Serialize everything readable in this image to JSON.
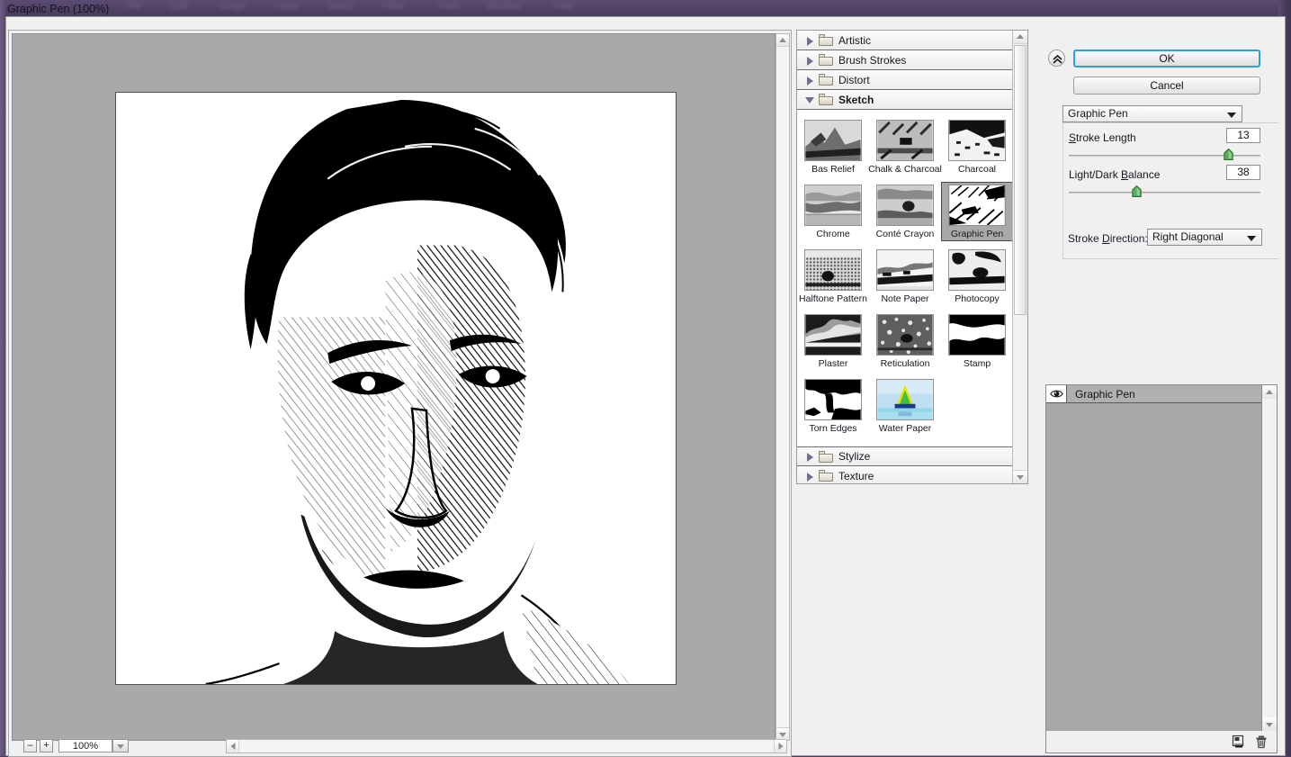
{
  "dialog": {
    "title": "Graphic Pen (100%)"
  },
  "background_menu": {
    "items": [
      "File",
      "Edit",
      "Image",
      "Layer",
      "Select",
      "Filter",
      "View",
      "Window",
      "Help"
    ]
  },
  "preview": {
    "zoom_out_label": "–",
    "zoom_in_label": "+",
    "zoom_value": "100%",
    "zoom_dropdown_icon": "chevron-down-icon",
    "scroll_up_icon": "triangle-up-icon",
    "scroll_down_icon": "triangle-down-icon",
    "scroll_left_icon": "triangle-left-icon",
    "scroll_right_icon": "triangle-right-icon",
    "image_description": "Graphic Pen filtered black-and-white portrait of a man"
  },
  "filter_browser": {
    "categories": [
      {
        "label": "Artistic",
        "expanded": false,
        "arrow_icon": "triangle-right-icon",
        "folder_icon": "folder-closed-icon"
      },
      {
        "label": "Brush Strokes",
        "expanded": false,
        "arrow_icon": "triangle-right-icon",
        "folder_icon": "folder-closed-icon"
      },
      {
        "label": "Distort",
        "expanded": false,
        "arrow_icon": "triangle-right-icon",
        "folder_icon": "folder-closed-icon"
      },
      {
        "label": "Sketch",
        "expanded": true,
        "arrow_icon": "triangle-down-icon",
        "folder_icon": "folder-open-icon"
      },
      {
        "label": "Stylize",
        "expanded": false,
        "arrow_icon": "triangle-right-icon",
        "folder_icon": "folder-closed-icon"
      },
      {
        "label": "Texture",
        "expanded": false,
        "arrow_icon": "triangle-right-icon",
        "folder_icon": "folder-closed-icon"
      }
    ],
    "sketch_filters": [
      {
        "label": "Bas Relief",
        "selected": false
      },
      {
        "label": "Chalk & Charcoal",
        "selected": false
      },
      {
        "label": "Charcoal",
        "selected": false
      },
      {
        "label": "Chrome",
        "selected": false
      },
      {
        "label": "Conté Crayon",
        "selected": false
      },
      {
        "label": "Graphic Pen",
        "selected": true
      },
      {
        "label": "Halftone Pattern",
        "selected": false
      },
      {
        "label": "Note Paper",
        "selected": false
      },
      {
        "label": "Photocopy",
        "selected": false
      },
      {
        "label": "Plaster",
        "selected": false
      },
      {
        "label": "Reticulation",
        "selected": false
      },
      {
        "label": "Stamp",
        "selected": false
      },
      {
        "label": "Torn Edges",
        "selected": false
      },
      {
        "label": "Water Paper",
        "selected": false
      }
    ]
  },
  "settings": {
    "collapse_icon": "double-chevron-up-icon",
    "ok_label": "OK",
    "cancel_label": "Cancel",
    "filter_select_value": "Graphic Pen",
    "filter_select_icon": "chevron-down-icon",
    "params": [
      {
        "label": "Stroke Length",
        "underline_char": "S",
        "value": "13",
        "slider_percent": 86
      },
      {
        "label": "Light/Dark Balance",
        "underline_char": "B",
        "value": "38",
        "slider_percent": 38
      }
    ],
    "stroke_direction_label": "Stroke Direction:",
    "stroke_direction_value": "Right Diagonal",
    "stroke_direction_icon": "chevron-down-icon"
  },
  "effects": {
    "rows": [
      {
        "name": "Graphic Pen",
        "visible": true,
        "selected": true,
        "eye_icon": "eye-icon"
      }
    ],
    "new_effect_icon": "new-effect-layer-icon",
    "delete_effect_icon": "trash-icon"
  },
  "colors": {
    "accent_focus_border": "#2f9fe0",
    "slider_thumb_green": "#4f9d4f",
    "selection_gray": "#a9a9a9",
    "dialog_bg": "#f0f0f0",
    "canvas_gray": "#a9a9a9",
    "title_bar_purple": "#4e4062"
  }
}
